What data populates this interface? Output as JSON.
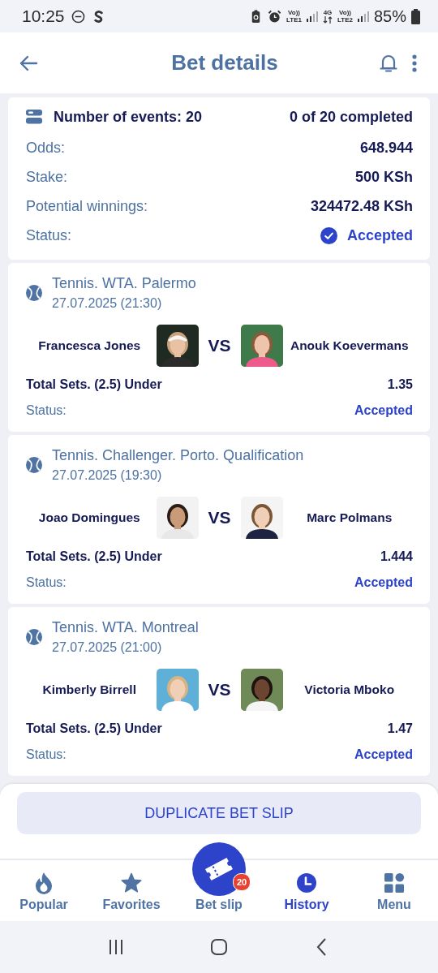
{
  "status_bar": {
    "time": "10:25",
    "network": [
      {
        "kind": "sim",
        "top": "Vo))",
        "bottom": "LTE1"
      },
      {
        "kind": "data",
        "top": "4G"
      },
      {
        "kind": "sim",
        "top": "Vo))",
        "bottom": "LTE2"
      }
    ],
    "battery": "85%"
  },
  "header": {
    "title": "Bet details"
  },
  "summary": {
    "events_label": "Number of events: 20",
    "progress": "0 of 20 completed",
    "rows": [
      {
        "kind": "text",
        "label": "Odds:",
        "value": "648.944"
      },
      {
        "kind": "text",
        "label": "Stake:",
        "value": "500 KSh"
      },
      {
        "kind": "text",
        "label": "Potential winnings:",
        "value": "324472.48 KSh"
      },
      {
        "kind": "status",
        "label": "Status:",
        "value": "Accepted"
      }
    ]
  },
  "events": [
    {
      "title": "Tennis. WTA. Palermo",
      "datetime": "27.07.2025 (21:30)",
      "player_1": "Francesca Jones",
      "vs": "VS",
      "player_2": "Anouk Koevermans",
      "market": "Total Sets. (2.5) Under",
      "odds": "1.35",
      "status_label": "Status:",
      "status": "Accepted"
    },
    {
      "title": "Tennis. Challenger. Porto. Qualification",
      "datetime": "27.07.2025 (19:30)",
      "player_1": "Joao Domingues",
      "vs": "VS",
      "player_2": "Marc Polmans",
      "market": "Total Sets. (2.5) Under",
      "odds": "1.444",
      "status_label": "Status:",
      "status": "Accepted"
    },
    {
      "title": "Tennis. WTA. Montreal",
      "datetime": "27.07.2025 (21:00)",
      "player_1": "Kimberly Birrell",
      "vs": "VS",
      "player_2": "Victoria Mboko",
      "market": "Total Sets. (2.5) Under",
      "odds": "1.47",
      "status_label": "Status:",
      "status": "Accepted"
    }
  ],
  "action_button": "DUPLICATE BET SLIP",
  "nav": [
    {
      "kind": "flame",
      "label": "Popular",
      "selected": false
    },
    {
      "kind": "star",
      "label": "Favorites",
      "selected": false
    },
    {
      "kind": "ticket",
      "label": "Bet slip",
      "badge": "20",
      "selected": false
    },
    {
      "kind": "clock",
      "label": "History",
      "selected": true
    },
    {
      "kind": "grid",
      "label": "Menu",
      "selected": false
    }
  ]
}
